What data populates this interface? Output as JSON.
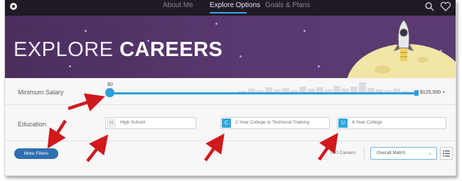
{
  "nav": {
    "items": [
      "About Me",
      "Explore Options",
      "Goals & Plans"
    ],
    "active_index": 1,
    "logo_icon": "circle-logo-icon",
    "search_icon": "search-icon",
    "favorites_icon": "heart-icon"
  },
  "hero": {
    "title_light": "EXPLORE",
    "title_bold": "CAREERS"
  },
  "salary": {
    "label": "Minimum Salary",
    "current_value": "$0",
    "max_label": "$125,000 +"
  },
  "education": {
    "label": "Education",
    "options": [
      {
        "badge": "H",
        "label": "High School",
        "selected": false
      },
      {
        "badge": "C",
        "label": "2-Year College or Technical Training",
        "selected": true
      },
      {
        "badge": "U",
        "label": "4-Year College",
        "selected": true
      }
    ]
  },
  "footer": {
    "more_filters_label": "More Filters",
    "careers_count": "540 Careers",
    "sort_value": "Overall Match",
    "list_view_icon": "list-view-icon"
  },
  "annotation": {
    "arrow_color": "#d0191b",
    "arrow_count": 6
  },
  "colors": {
    "accent": "#2f9fd8",
    "button": "#2f6fb0",
    "hero": "#4b2e5e",
    "nav": "#1f1a24"
  }
}
